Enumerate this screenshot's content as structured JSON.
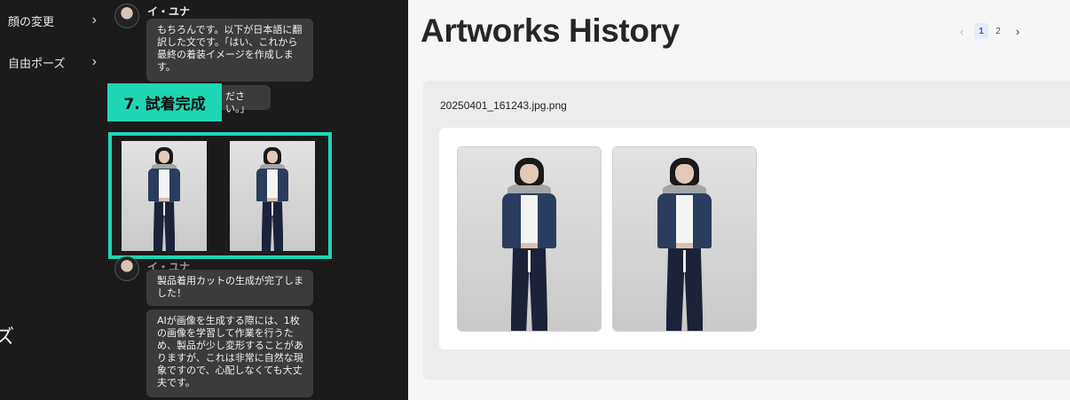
{
  "sidebar": {
    "menu": [
      {
        "label": "顔の変更",
        "chevron": "›"
      },
      {
        "label": "自由ポーズ",
        "chevron": "›"
      }
    ],
    "edge_glyph": "ズ"
  },
  "chat": {
    "messages": [
      {
        "user": "イ・ユナ",
        "text": "もちろんです。以下が日本語に翻訳した文です。「はい、これから最終の着装イメージを作成します。"
      },
      {
        "text": "ださい。」"
      },
      {
        "user": "イ・ユナ",
        "text": "製品着用カットの生成が完了しました！"
      },
      {
        "text": "AIが画像を生成する際には、1枚の画像を学習して作業を行うため、製品が少し変形することがありますが、これは非常に自然な現象ですので、心配しなくても大丈夫です。"
      }
    ],
    "step_label": "7. 試着完成",
    "thumbnail_count": 2
  },
  "main": {
    "title": "Artworks History",
    "pagination": {
      "prev": "‹",
      "pages": [
        "1",
        "2"
      ],
      "current": "1",
      "next": "›"
    },
    "file": {
      "name": "20250401_161243.jpg.png",
      "image_count": 2
    }
  },
  "colors": {
    "accent": "#1fd6b4",
    "left_panel_bg": "#1b1b1b",
    "bubble_bg": "#3b3b3b",
    "page_bg": "#f6f6f6",
    "active_page_bg": "#e4ecf8"
  }
}
